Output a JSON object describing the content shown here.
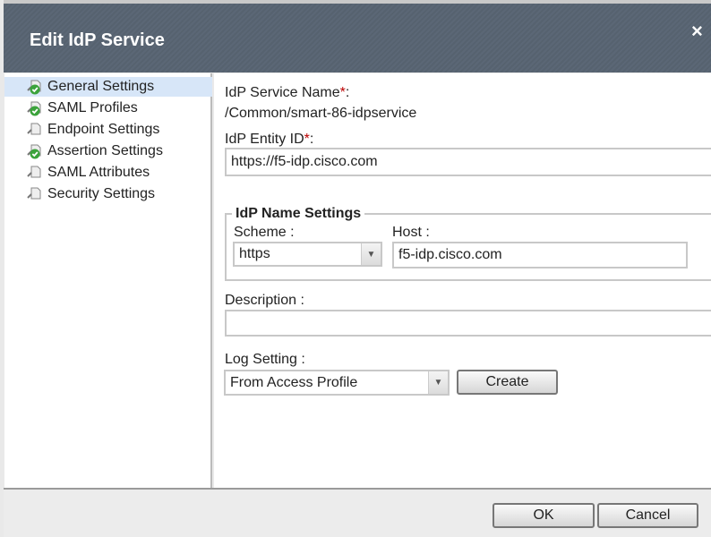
{
  "dialog": {
    "title": "Edit IdP Service",
    "close_label": "×"
  },
  "sidebar": {
    "items": [
      {
        "label": "General Settings",
        "icon": "check-icon",
        "selected": true
      },
      {
        "label": "SAML Profiles",
        "icon": "check-icon"
      },
      {
        "label": "Endpoint Settings",
        "icon": "document-icon"
      },
      {
        "label": "Assertion Settings",
        "icon": "check-icon"
      },
      {
        "label": "SAML Attributes",
        "icon": "document-icon"
      },
      {
        "label": "Security Settings",
        "icon": "document-icon"
      }
    ]
  },
  "form": {
    "service_name_label": "IdP Service Name",
    "service_name_suffix": ":",
    "required_mark": "*",
    "service_name_value": "/Common/smart-86-idpservice",
    "entity_id_label": "IdP Entity ID",
    "entity_id_suffix": ":",
    "entity_id_value": "https://f5-idp.cisco.com",
    "name_settings_legend": "IdP Name Settings",
    "scheme_label": "Scheme :",
    "scheme_value": "https",
    "host_label": "Host :",
    "host_value": "f5-idp.cisco.com",
    "description_label": "Description :",
    "description_value": "",
    "log_setting_label": "Log Setting :",
    "log_setting_value": "From Access Profile",
    "create_label": "Create"
  },
  "footer": {
    "ok_label": "OK",
    "cancel_label": "Cancel"
  }
}
